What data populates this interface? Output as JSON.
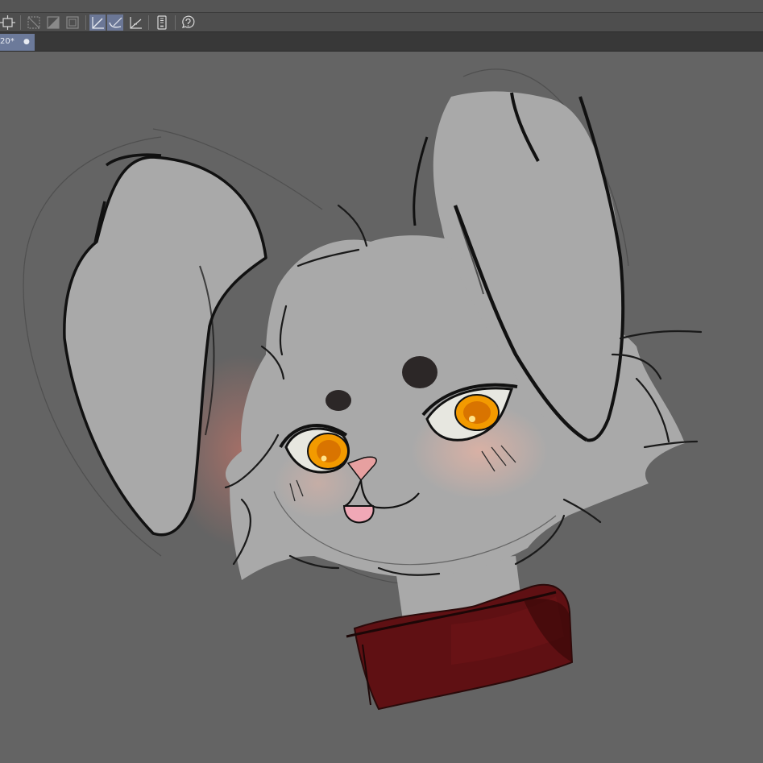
{
  "document_tab": {
    "label": "20*",
    "close_glyph": "●"
  },
  "toolbar": {
    "tools": [
      "transform-icon",
      "clear-outside-selection-icon",
      "fill-selection-icon",
      "border-selection-icon",
      "straight-line-ruler-icon",
      "curve-ruler-icon",
      "perspective-ruler-icon",
      "tablet-icon",
      "help-icon"
    ]
  },
  "colors": {
    "canvas_bg": "#646464",
    "fur": "#a9a9a9",
    "collar": "#5f1013",
    "eye_iris": "#f39a00",
    "blush": "#e8b3a3",
    "tab_active": "#6c7a9a",
    "tool_active": "#6b7796"
  }
}
